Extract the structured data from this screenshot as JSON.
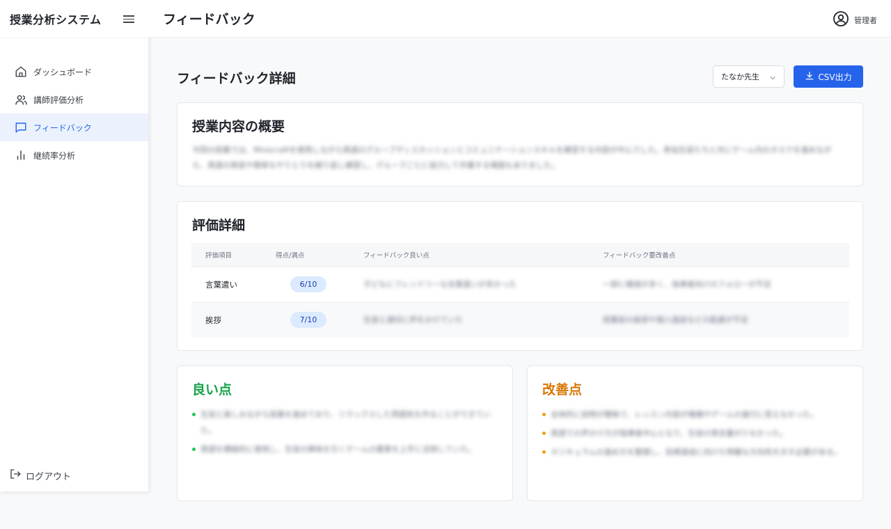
{
  "app": {
    "title": "授業分析システム"
  },
  "sidebar": {
    "items": [
      {
        "label": "ダッシュボード",
        "icon": "home-icon",
        "active": false
      },
      {
        "label": "講師評価分析",
        "icon": "users-icon",
        "active": false
      },
      {
        "label": "フィードバック",
        "icon": "message-square-icon",
        "active": true
      },
      {
        "label": "継続率分析",
        "icon": "bar-chart-icon",
        "active": false
      }
    ],
    "logout_label": "ログアウト"
  },
  "header": {
    "title": "フィードバック",
    "user_label": "管理者"
  },
  "main": {
    "section_title": "フィードバック詳細",
    "teacher_select": {
      "value": "たなか先生"
    },
    "csv_button": {
      "label": "CSV出力"
    },
    "summary": {
      "title": "授業内容の概要",
      "text": "今回の授業では、Minecraftを使用しながら英語のグループディスカッションとコミュニケーションスキルを練習する内容が中心でした。参加生徒たちと共にゲーム内のタスクを進めながら、英語の発音や簡単なやりとりを繰り返し練習し、グループごとに協力して作業する場面もありました。"
    },
    "evaluation": {
      "title": "評価詳細",
      "columns": [
        "評価項目",
        "得点/満点",
        "フィードバック良い点",
        "フィードバック要改善点"
      ],
      "rows": [
        {
          "item": "言葉遣い",
          "score": "6/10",
          "good": "子どもにフレンドリーな言葉遣いが多かった",
          "improve": "一部に雑語が多く、指導者向けのフォローが不足"
        },
        {
          "item": "挨拶",
          "score": "7/10",
          "good": "生徒と適切に声をかけていた",
          "improve": "授業前の挨拶や個人面談などの配慮が不足"
        }
      ]
    },
    "good_points": {
      "title": "良い点",
      "items": [
        "生徒と楽しみながら授業を進めており、リラックスした雰囲気を作ることができていた。",
        "英語を積極的に使用し、生徒の興味を引くゲームの要素を上手に活用していた。"
      ]
    },
    "improvements": {
      "title": "改善点",
      "items": [
        "全体的に説明が曖昧で、レッスン内容が複雑やゲームの進行に見えなかった。",
        "英語での声かけ方が指導者中心となり、生徒の発言量が少なかった。",
        "カリキュラムの進め方を整理し、目標達成に向けた明確な方向性を示す必要がある。"
      ]
    },
    "colors": {
      "accent": "#2563eb",
      "good": "#16a34a",
      "improve": "#d97706",
      "badge_bg": "#dbeafe"
    }
  }
}
